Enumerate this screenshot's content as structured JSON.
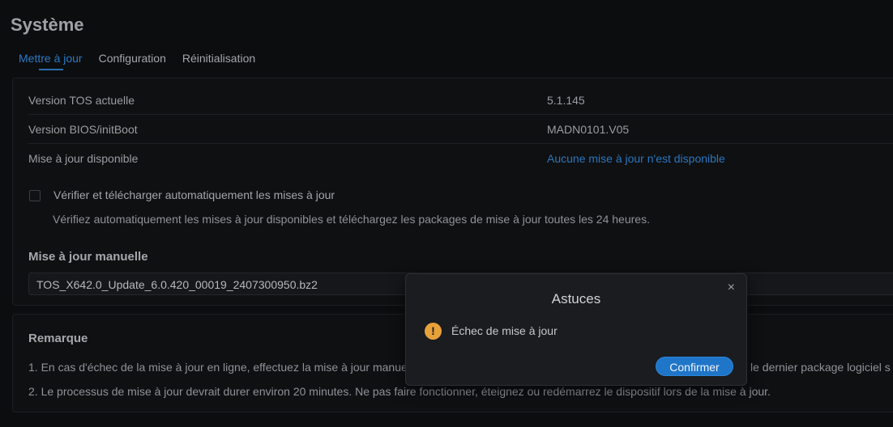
{
  "page": {
    "title": "Système"
  },
  "tabs": [
    {
      "label": "Mettre à jour"
    },
    {
      "label": "Configuration"
    },
    {
      "label": "Réinitialisation"
    }
  ],
  "info": [
    {
      "label": "Version TOS actuelle",
      "value": "5.1.145"
    },
    {
      "label": "Version BIOS/initBoot",
      "value": "MADN0101.V05"
    },
    {
      "label": "Mise à jour disponible",
      "value": "Aucune mise à jour n'est disponible"
    }
  ],
  "auto_update": {
    "label": "Vérifier et télécharger automatiquement les mises à jour",
    "description": "Vérifiez automatiquement les mises à jour disponibles et téléchargez les packages de mise à jour toutes les 24 heures.",
    "checked": false
  },
  "manual": {
    "title": "Mise à jour manuelle",
    "file": "TOS_X642.0_Update_6.0.420_00019_2407300950.bz2"
  },
  "notes": {
    "title": "Remarque",
    "items": [
      "1. En cas d'échec de la mise à jour en ligne, effectuez la mise à jour manuelle",
      "2. Le processus de mise à jour devrait durer environ 20 minutes. Ne pas faire fonctionner, éteignez ou redémarrez le dispositif lors de la mise à jour."
    ],
    "item1_tail": "le dernier package logiciel s"
  },
  "dialog": {
    "title": "Astuces",
    "message": "Échec de mise à jour",
    "confirm_label": "Confirmer",
    "close_icon": "×",
    "warn_icon": "!"
  },
  "colors": {
    "accent": "#1f75c8",
    "link": "#2a76bf",
    "warning": "#e8a23a"
  }
}
